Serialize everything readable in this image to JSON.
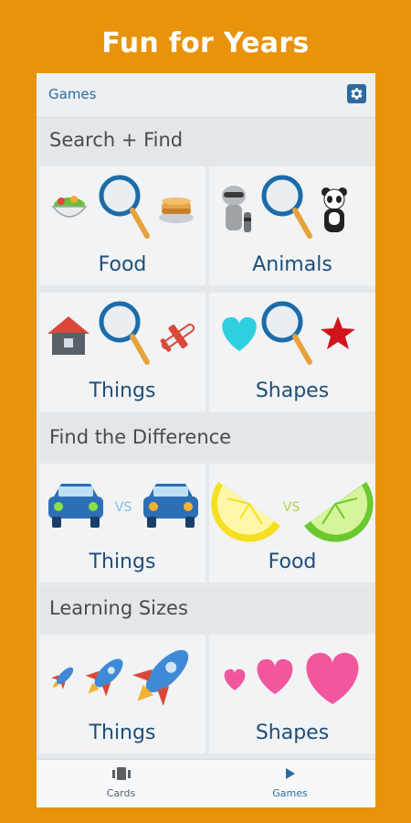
{
  "promo": {
    "title": "Fun for Years"
  },
  "appbar": {
    "title": "Games",
    "settings_icon": "gear-icon"
  },
  "sections": [
    {
      "title": "Search + Find",
      "cards": [
        {
          "label": "Food",
          "icon": "search-food-icon"
        },
        {
          "label": "Animals",
          "icon": "search-animals-icon"
        },
        {
          "label": "Things",
          "icon": "search-things-icon"
        },
        {
          "label": "Shapes",
          "icon": "search-shapes-icon"
        }
      ]
    },
    {
      "title": "Find the Difference",
      "cards": [
        {
          "label": "Things",
          "icon": "cars-vs-icon",
          "vs": "VS"
        },
        {
          "label": "Food",
          "icon": "limes-vs-icon",
          "vs": "VS"
        }
      ]
    },
    {
      "title": "Learning Sizes",
      "cards": [
        {
          "label": "Things",
          "icon": "rockets-sizes-icon"
        },
        {
          "label": "Shapes",
          "icon": "hearts-sizes-icon"
        }
      ]
    }
  ],
  "bottom_nav": [
    {
      "label": "Cards",
      "icon": "cards-icon",
      "active": false
    },
    {
      "label": "Games",
      "icon": "play-icon",
      "active": true
    }
  ],
  "colors": {
    "background": "#E8930C",
    "primary": "#2C6A9E",
    "label": "#1F4E79"
  }
}
